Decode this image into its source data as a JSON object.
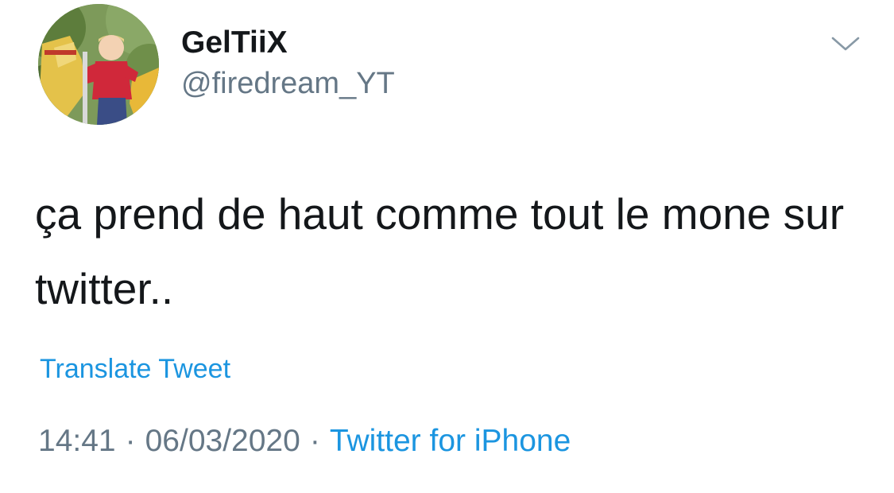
{
  "user": {
    "display_name": "GelTiiX",
    "handle": "@firedream_YT",
    "avatar_icon": "avatar-photo"
  },
  "menu": {
    "icon": "chevron-down-icon"
  },
  "tweet": {
    "text": "ça prend de haut comme tout le mone sur twitter..",
    "translate_label": "Translate Tweet",
    "time": "14:41",
    "separator": "·",
    "date": "06/03/2020",
    "source": "Twitter for iPhone"
  },
  "colors": {
    "link": "#1b95e0",
    "secondary_text": "#657786",
    "primary_text": "#14171a"
  }
}
